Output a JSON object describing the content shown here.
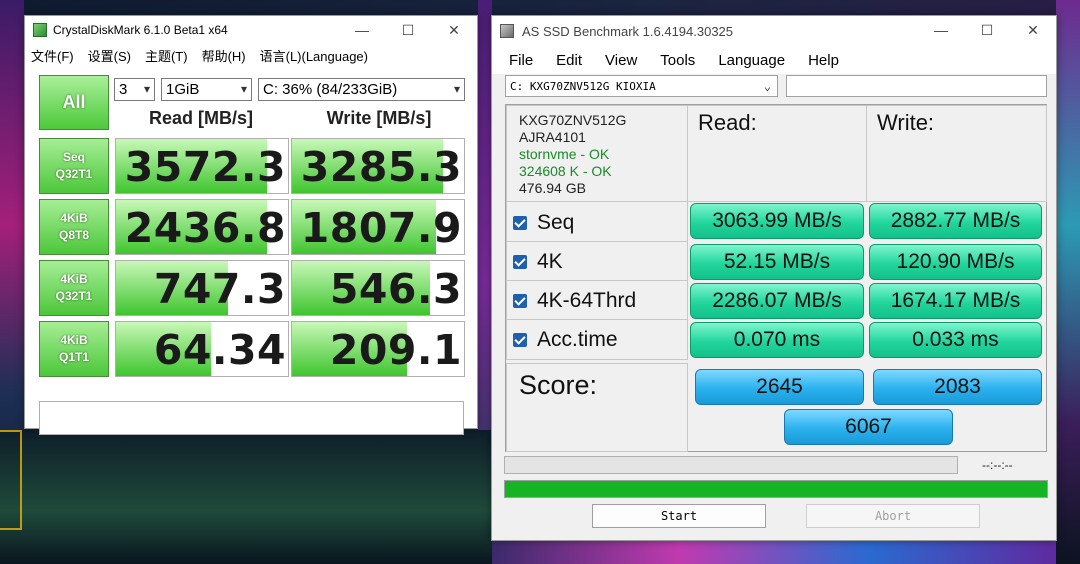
{
  "cdm": {
    "title": "CrystalDiskMark 6.1.0 Beta1 x64",
    "menu": [
      "文件(F)",
      "设置(S)",
      "主题(T)",
      "帮助(H)",
      "语言(L)(Language)"
    ],
    "all_label": "All",
    "count": "3",
    "size": "1GiB",
    "drive": "C: 36% (84/233GiB)",
    "read_header": "Read [MB/s]",
    "write_header": "Write [MB/s]",
    "rows": [
      {
        "line1": "Seq",
        "line2": "Q32T1",
        "read": "3572.3",
        "write": "3285.3",
        "read_frac": 0.88,
        "write_frac": 0.88
      },
      {
        "line1": "4KiB",
        "line2": "Q8T8",
        "read": "2436.8",
        "write": "1807.9",
        "read_frac": 0.88,
        "write_frac": 0.84
      },
      {
        "line1": "4KiB",
        "line2": "Q32T1",
        "read": "747.3",
        "write": "546.3",
        "read_frac": 0.65,
        "write_frac": 0.8
      },
      {
        "line1": "4KiB",
        "line2": "Q1T1",
        "read": "64.34",
        "write": "209.1",
        "read_frac": 0.55,
        "write_frac": 0.67
      }
    ]
  },
  "asd": {
    "title": "AS SSD Benchmark 1.6.4194.30325",
    "menu": [
      "File",
      "Edit",
      "View",
      "Tools",
      "Language",
      "Help"
    ],
    "drive_select": "C: KXG70ZNV512G KIOXIA",
    "info": {
      "model": "KXG70ZNV512G",
      "firmware": "AJRA4101",
      "driver": "stornvme - OK",
      "alignment": "324608 K - OK",
      "capacity": "476.94 GB"
    },
    "read_header": "Read:",
    "write_header": "Write:",
    "rows": [
      {
        "label": "Seq",
        "read": "3063.99 MB/s",
        "write": "2882.77 MB/s"
      },
      {
        "label": "4K",
        "read": "52.15 MB/s",
        "write": "120.90 MB/s"
      },
      {
        "label": "4K-64Thrd",
        "read": "2286.07 MB/s",
        "write": "1674.17 MB/s"
      },
      {
        "label": "Acc.time",
        "read": "0.070 ms",
        "write": "0.033 ms"
      }
    ],
    "score_label": "Score:",
    "score_read": "2645",
    "score_write": "2083",
    "score_total": "6067",
    "time_text": "--:--:--",
    "progress": 1.0,
    "start_label": "Start",
    "abort_label": "Abort"
  }
}
